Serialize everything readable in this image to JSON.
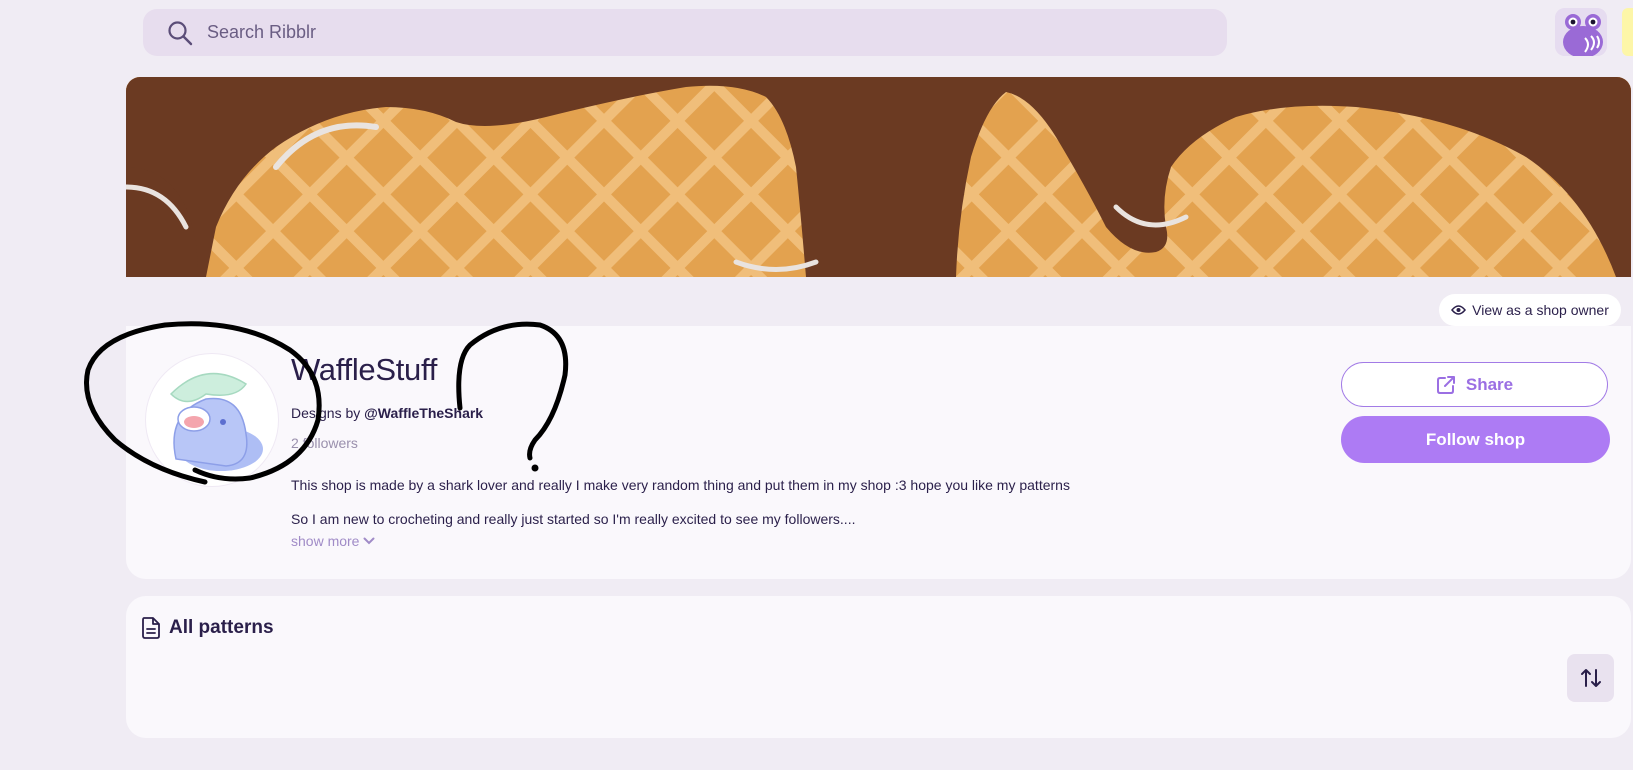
{
  "search": {
    "placeholder": "Search Ribblr",
    "icon": "search-icon"
  },
  "shop": {
    "name": "WaffleStuff",
    "designs_prefix": "Designs by ",
    "designer_handle": "@WaffleTheShark",
    "followers": "2 followers",
    "description": [
      "This shop is made by a shark lover and really I make very random thing and put them in my shop :3 hope you like my patterns",
      "So I am new to crocheting and really just started so I'm really excited to see my followers...."
    ],
    "show_more": "show more"
  },
  "actions": {
    "view_as_owner": "View as a shop owner",
    "share": "Share",
    "follow": "Follow shop"
  },
  "patterns": {
    "title": "All patterns"
  },
  "colors": {
    "accent": "#ad7bf4",
    "text": "#2a1f4a",
    "background": "#f0ecf4",
    "banner_waffle": "#e8b46b",
    "banner_chocolate": "#6b3a22"
  }
}
